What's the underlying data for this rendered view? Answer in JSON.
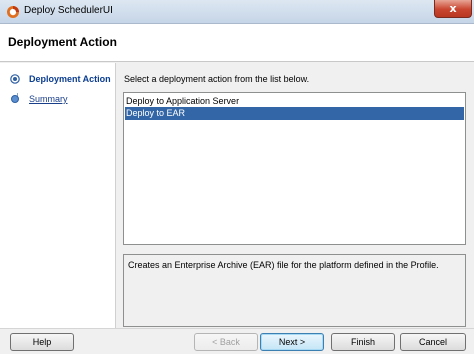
{
  "window": {
    "title": "Deploy SchedulerUI",
    "close_glyph": "x"
  },
  "header": {
    "title": "Deployment Action"
  },
  "nav": {
    "items": [
      {
        "label": "Deployment Action",
        "state": "current",
        "icon": "step-current-icon"
      },
      {
        "label": "Summary",
        "state": "link",
        "icon": "step-link-icon"
      }
    ]
  },
  "main": {
    "instruction": "Select a deployment action from the list below.",
    "actions": [
      {
        "label": "Deploy to Application Server",
        "selected": false
      },
      {
        "label": "Deploy to EAR",
        "selected": true
      }
    ],
    "description": "Creates an Enterprise Archive (EAR) file for the platform defined in the Profile."
  },
  "footer": {
    "help": "Help",
    "back": "< Back",
    "next": "Next >",
    "finish": "Finish",
    "cancel": "Cancel"
  },
  "colors": {
    "selection": "#3366a6",
    "close_button": "#c9452f",
    "current_step": "#0b3d91"
  }
}
